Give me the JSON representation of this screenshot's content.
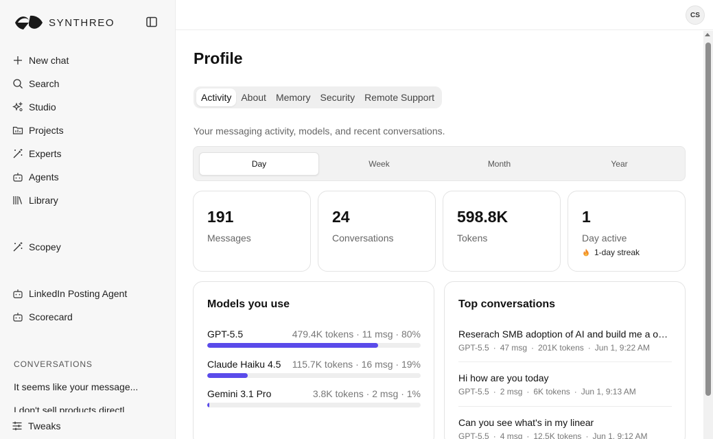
{
  "brand": {
    "name": "SYNTHREO"
  },
  "sidebar": {
    "items": [
      {
        "label": "New chat",
        "icon": "plus-icon"
      },
      {
        "label": "Search",
        "icon": "search-icon"
      },
      {
        "label": "Studio",
        "icon": "sparkles-icon"
      },
      {
        "label": "Projects",
        "icon": "folder-icon"
      },
      {
        "label": "Experts",
        "icon": "magic-wand-icon"
      },
      {
        "label": "Agents",
        "icon": "robot-icon"
      },
      {
        "label": "Library",
        "icon": "library-icon"
      }
    ],
    "pinned": [
      {
        "label": "Scopey",
        "icon": "magic-wand-icon"
      }
    ],
    "agents": [
      {
        "label": "LinkedIn Posting Agent",
        "icon": "robot-icon"
      },
      {
        "label": "Scorecard",
        "icon": "robot-icon"
      }
    ],
    "conversations_label": "CONVERSATIONS",
    "conversations": [
      "It seems like your message...",
      "I don't sell products directl"
    ],
    "tweaks_label": "Tweaks"
  },
  "user": {
    "initials": "CS"
  },
  "page": {
    "title": "Profile",
    "tabs": [
      "Activity",
      "About",
      "Memory",
      "Security",
      "Remote Support"
    ],
    "active_tab": "Activity",
    "subtitle": "Your messaging activity, models, and recent conversations."
  },
  "period": {
    "options": [
      "Day",
      "Week",
      "Month",
      "Year"
    ],
    "selected": "Day"
  },
  "stats": [
    {
      "value": "191",
      "label": "Messages"
    },
    {
      "value": "24",
      "label": "Conversations"
    },
    {
      "value": "598.8K",
      "label": "Tokens"
    },
    {
      "value": "1",
      "label": "Day active",
      "streak": "1-day streak"
    }
  ],
  "models_card": {
    "title": "Models you use",
    "models": [
      {
        "name": "GPT-5.5",
        "meta": "479.4K tokens · 11 msg · 80%",
        "share": 0.8
      },
      {
        "name": "Claude Haiku 4.5",
        "meta": "115.7K tokens · 16 msg · 19%",
        "share": 0.19
      },
      {
        "name": "Gemini 3.1 Pro",
        "meta": "3.8K tokens · 2 msg · 1%",
        "share": 0.01
      }
    ]
  },
  "top_conversations": {
    "title": "Top conversations",
    "items": [
      {
        "title": "Reserach SMB adoption of AI and build me a one-pager",
        "model": "GPT-5.5",
        "messages": "47 msg",
        "tokens": "201K tokens",
        "time": "Jun 1, 9:22 AM"
      },
      {
        "title": "Hi how are you today",
        "model": "GPT-5.5",
        "messages": "2 msg",
        "tokens": "6K tokens",
        "time": "Jun 1, 9:13 AM"
      },
      {
        "title": "Can you see what's in my linear",
        "model": "GPT-5.5",
        "messages": "4 msg",
        "tokens": "12.5K tokens",
        "time": "Jun 1, 9:12 AM"
      }
    ]
  },
  "colors": {
    "accent": "#5a4bea",
    "sidebar_bg": "#f7f7f7"
  }
}
